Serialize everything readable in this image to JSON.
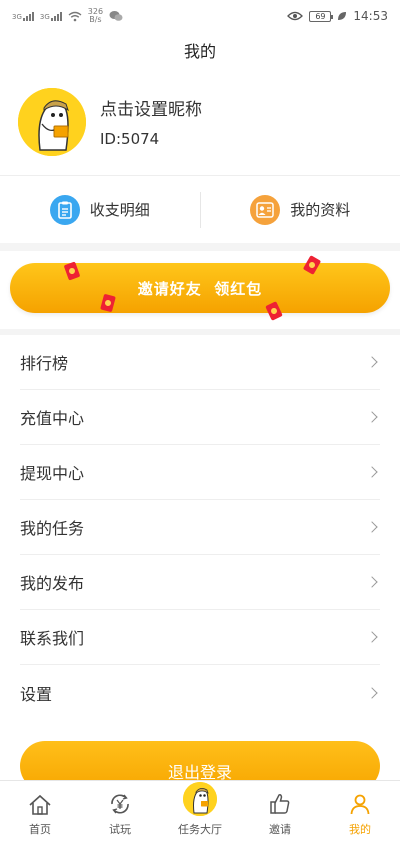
{
  "status_bar": {
    "signal1_tag": "3G",
    "signal2_tag": "3G",
    "network_speed": "326",
    "network_speed_unit": "B/s",
    "battery": "69",
    "time": "14:53"
  },
  "header": {
    "title": "我的"
  },
  "profile": {
    "nickname": "点击设置昵称",
    "user_id": "ID:5074"
  },
  "quick_actions": [
    {
      "label": "收支明细",
      "icon": "ledger-icon",
      "color": "#3aa7f0"
    },
    {
      "label": "我的资料",
      "icon": "profile-card-icon",
      "color": "#f5a23c"
    }
  ],
  "banner": {
    "label": "邀请好友  领红包"
  },
  "menu": {
    "items": [
      {
        "label": "排行榜"
      },
      {
        "label": "充值中心"
      },
      {
        "label": "提现中心"
      },
      {
        "label": "我的任务"
      },
      {
        "label": "我的发布"
      },
      {
        "label": "联系我们"
      },
      {
        "label": "设置"
      }
    ]
  },
  "logout": {
    "label": "退出登录"
  },
  "tabbar": {
    "tabs": [
      {
        "label": "首页",
        "icon": "home-icon"
      },
      {
        "label": "试玩",
        "icon": "refresh-yen-icon"
      },
      {
        "label": "任务大厅",
        "icon": "mascot-icon"
      },
      {
        "label": "邀请",
        "icon": "thumbs-up-icon"
      },
      {
        "label": "我的",
        "icon": "person-icon",
        "active": true
      }
    ]
  },
  "colors": {
    "accent": "#f5a200",
    "accent_light": "#ffc61a",
    "background": "#f4f4f4"
  }
}
